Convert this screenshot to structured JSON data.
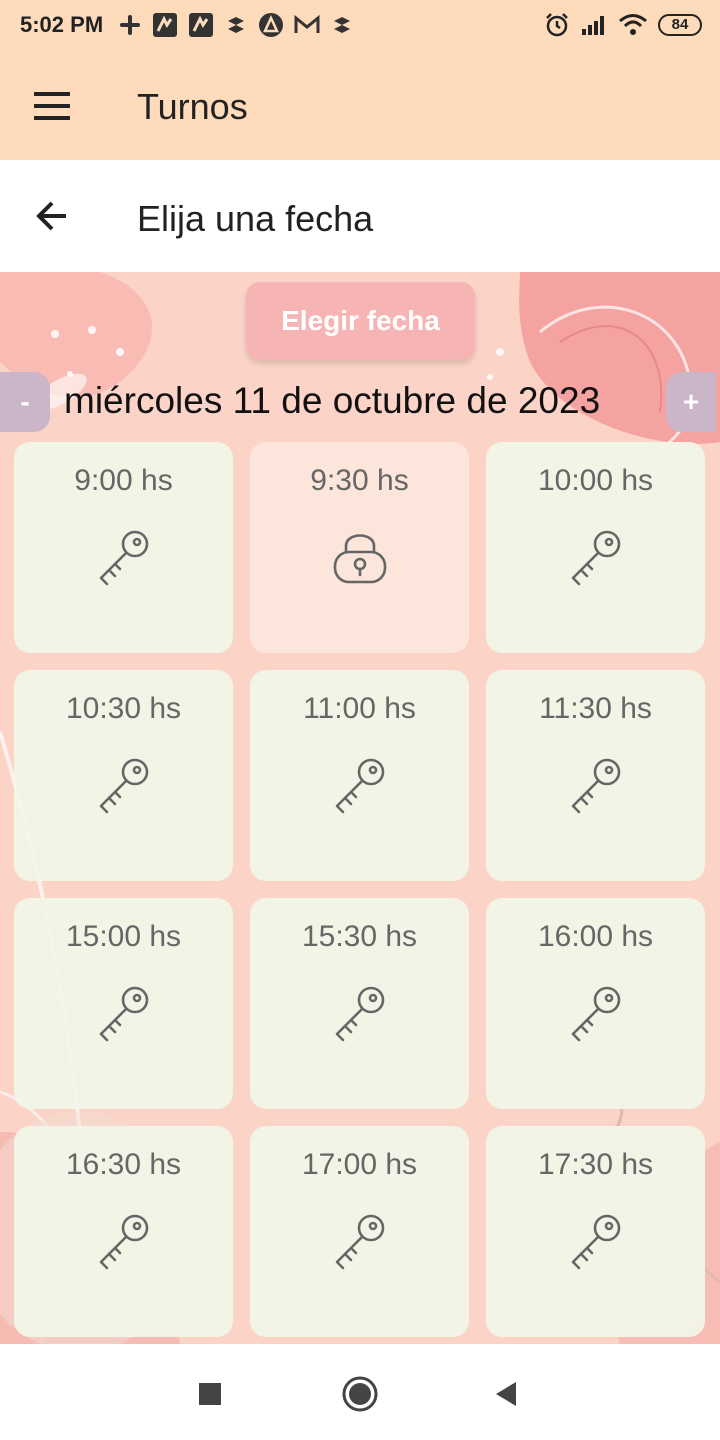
{
  "status_bar": {
    "time": "5:02 PM",
    "left_icons": [
      "slack-icon",
      "kick-app-icon",
      "kick-app-icon",
      "dropbox-icon",
      "triangle-app-icon",
      "gmail-icon",
      "dropbox-icon"
    ],
    "right_icons": [
      "alarm-icon",
      "signal-icon",
      "wifi-icon"
    ],
    "battery": "84"
  },
  "app_bar": {
    "title": "Turnos",
    "menu_icon": "hamburger-icon"
  },
  "sub_header": {
    "title": "Elija una fecha",
    "back_icon": "arrow-back-icon"
  },
  "date_picker": {
    "button_label": "Elegir fecha",
    "prev_label": "-",
    "next_label": "+",
    "selected_date": "miércoles 11 de octubre de 2023"
  },
  "slots": [
    {
      "time": "9:00 hs",
      "status": "available",
      "icon": "key-icon"
    },
    {
      "time": "9:30 hs",
      "status": "booked",
      "icon": "lock-icon"
    },
    {
      "time": "10:00 hs",
      "status": "available",
      "icon": "key-icon"
    },
    {
      "time": "10:30 hs",
      "status": "available",
      "icon": "key-icon"
    },
    {
      "time": "11:00 hs",
      "status": "available",
      "icon": "key-icon"
    },
    {
      "time": "11:30 hs",
      "status": "available",
      "icon": "key-icon"
    },
    {
      "time": "15:00 hs",
      "status": "available",
      "icon": "key-icon"
    },
    {
      "time": "15:30 hs",
      "status": "available",
      "icon": "key-icon"
    },
    {
      "time": "16:00 hs",
      "status": "available",
      "icon": "key-icon"
    },
    {
      "time": "16:30 hs",
      "status": "available",
      "icon": "key-icon"
    },
    {
      "time": "17:00 hs",
      "status": "available",
      "icon": "key-icon"
    },
    {
      "time": "17:30 hs",
      "status": "available",
      "icon": "key-icon"
    }
  ],
  "nav_bar": {
    "buttons": [
      "recents-square-icon",
      "home-circle-icon",
      "back-triangle-icon"
    ]
  },
  "colors": {
    "app_bar": "#fddbbb",
    "background": "#fbd3c7",
    "slot_available": "#f1f7e8",
    "slot_booked": "#fce6dc",
    "pick_button": "#f6b5b4",
    "nav_button": "#cbb6c9"
  }
}
